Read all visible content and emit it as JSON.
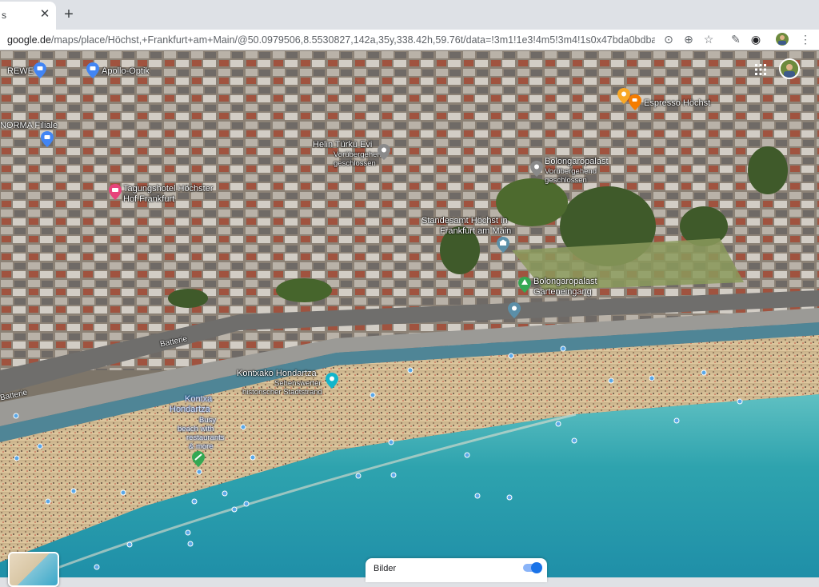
{
  "browser": {
    "tab_title": "s",
    "tab_close_icon": "close-icon",
    "new_tab_icon": "plus-icon",
    "url_host": "google.de",
    "url_path": "/maps/place/Höchst,+Frankfurt+am+Main/@50.0979506,8.5530827,142a,35y,338.42h,59.76t/data=!3m1!1e3!4m5!3m4!1s0x47bda0bdbab77173:0...",
    "toolbar_icons": [
      "location-icon",
      "zoom-icon",
      "star-icon",
      "eyedropper-icon",
      "extension-icon",
      "profile-icon",
      "menu-icon"
    ]
  },
  "map": {
    "places": [
      {
        "name": "REWE",
        "icon": "shopping-icon"
      },
      {
        "name": "Apollo-Optik",
        "icon": "shopping-icon"
      },
      {
        "name": "NORMA Filiale",
        "icon": "shopping-icon"
      },
      {
        "name": "Tagungshotel Höchster Hof Frankfurt",
        "line1": "Tagungshotel Höchster",
        "line2": "Hof Frankfurt",
        "icon": "hotel-icon"
      },
      {
        "name": "Helin Türkü Evi",
        "status1": "Vorübergehend",
        "status2": "geschlossen",
        "icon": "place-icon"
      },
      {
        "name": "Bolongaropalast",
        "status1": "Vorübergehend",
        "status2": "geschlossen",
        "icon": "place-icon"
      },
      {
        "name": "Espresso Höchst",
        "icon": "cafe-icon"
      },
      {
        "name": "Standesamt Höchst in Frankfurt am Main",
        "line1": "Standesamt Höchst in",
        "line2": "Frankfurt am Main",
        "icon": "government-icon"
      },
      {
        "name": "Bolongaropalast Garteneingang",
        "line1": "Bolongaropalast",
        "line2": "Garteneingang",
        "icon": "park-icon"
      },
      {
        "name": "Kontxako Hondartza",
        "sub1": "Sehenswerter",
        "sub2": "historischer Stadtstrand",
        "icon": "attraction-icon"
      },
      {
        "name": "Kontxa Hondartza",
        "line1": "Kontxa",
        "line2": "Hondartza",
        "desc": [
          "Busy",
          "beach with",
          "restaurants",
          "& more"
        ],
        "icon": "beach-icon"
      }
    ],
    "street_labels": [
      "Batterie",
      "Batterie"
    ],
    "apps_icon": "apps-grid-icon",
    "avatar": "account-avatar"
  },
  "imagery_card": {
    "label": "Bilder",
    "toggle_on": true
  },
  "colors": {
    "sea_deep": "#1f8fa8",
    "sea_shallow": "#5ec3c8",
    "sand": "#d8c39a",
    "chrome": "#dee1e6"
  }
}
